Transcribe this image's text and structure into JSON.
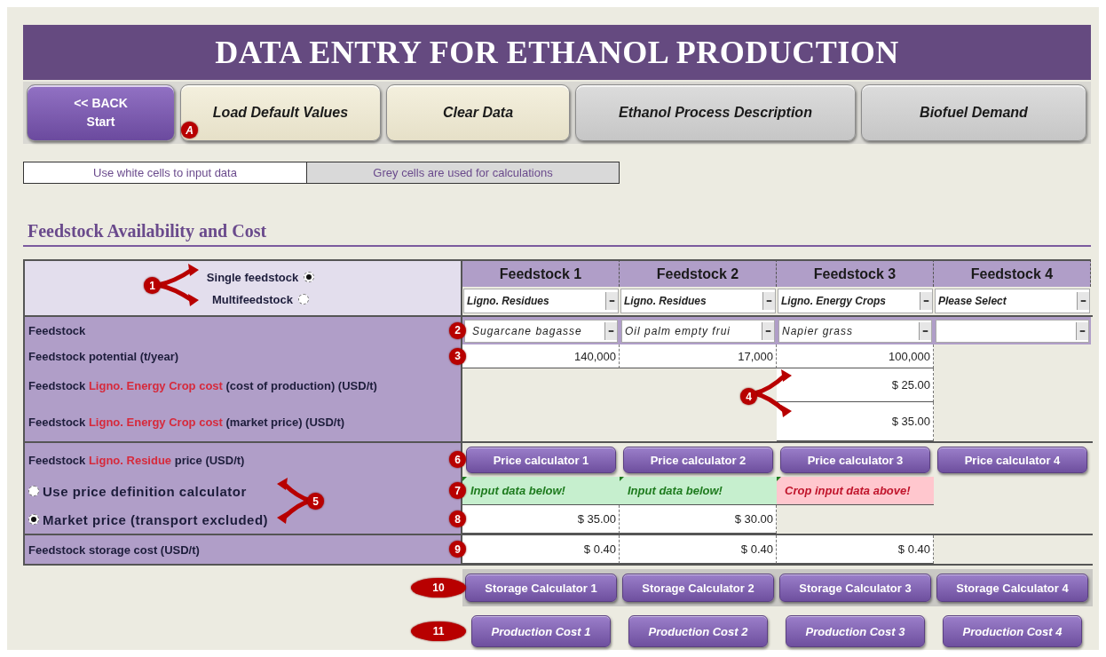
{
  "title": "DATA ENTRY FOR ETHANOL PRODUCTION",
  "nav_buttons": [
    {
      "kind": "back",
      "lines": [
        "<< BACK",
        "Start"
      ]
    },
    {
      "kind": "action",
      "lines": [
        "Load Default Values"
      ],
      "marker": "A"
    },
    {
      "kind": "action",
      "lines": [
        "Clear Data"
      ]
    },
    {
      "kind": "link",
      "lines": [
        "Ethanol Process Description"
      ]
    },
    {
      "kind": "link",
      "lines": [
        "Biofuel Demand"
      ]
    }
  ],
  "legend": [
    {
      "kind": "input",
      "text": "Use white cells to input data"
    },
    {
      "kind": "calc",
      "text": "Grey cells are used for calculations"
    }
  ],
  "section_title": "Feedstock Availability and Cost",
  "mode": {
    "marker": "1",
    "options": [
      {
        "label": "Single feedstock",
        "selected": true
      },
      {
        "label": "Multifeedstock",
        "selected": false
      }
    ]
  },
  "columns": [
    "Feedstock 1",
    "Feedstock 2",
    "Feedstock 3",
    "Feedstock 4"
  ],
  "feedstock_types": [
    "Ligno. Residues",
    "Ligno. Residues",
    "Ligno. Energy Crops",
    "Please Select"
  ],
  "row_groups": [
    [
      {
        "kind": "select",
        "marker": "2",
        "label": [
          {
            "text": "Feedstock",
            "highlight": false
          }
        ],
        "cells": [
          "Sugarcane bagasse",
          "Oil palm empty frui",
          "Napier grass",
          null
        ]
      },
      {
        "kind": "value",
        "marker": "3",
        "label": [
          {
            "text": "Feedstock potential (t/year)",
            "highlight": false
          }
        ],
        "cells": [
          "140,000",
          "17,000",
          "100,000",
          null
        ]
      },
      {
        "kind": "value",
        "callout": "4",
        "label": [
          {
            "text": "Feedstock ",
            "highlight": false
          },
          {
            "text": "Ligno. Energy Crop cost",
            "highlight": true
          },
          {
            "text": " (cost of production) (USD/t)",
            "highlight": false
          }
        ],
        "cells": [
          null,
          null,
          "$ 25.00",
          null
        ]
      },
      {
        "kind": "value",
        "label": [
          {
            "text": "Feedstock ",
            "highlight": false
          },
          {
            "text": "Ligno. Energy Crop cost",
            "highlight": true
          },
          {
            "text": " (market price) (USD/t)",
            "highlight": false
          }
        ],
        "cells": [
          null,
          null,
          "$ 35.00",
          null
        ]
      }
    ],
    [
      {
        "kind": "buttons",
        "marker": "6",
        "label": [
          {
            "text": "Feedstock ",
            "highlight": false
          },
          {
            "text": "Ligno. Residue",
            "highlight": true
          },
          {
            "text": " price (USD/t)",
            "highlight": false
          }
        ],
        "cells": [
          "Price calculator 1",
          "Price calculator 2",
          "Price calculator 3",
          "Price calculator 4"
        ]
      },
      {
        "kind": "status",
        "marker": "7",
        "callout": "5",
        "option": {
          "label": "Use price definition calculator",
          "selected": false
        },
        "cells": [
          {
            "text": "Input data below!",
            "kind": "ok"
          },
          {
            "text": "Input data below!",
            "kind": "ok"
          },
          {
            "text": "Crop input data above!",
            "kind": "warn"
          },
          null
        ]
      },
      {
        "kind": "value",
        "marker": "8",
        "option": {
          "label": "Market price (transport excluded)",
          "selected": true
        },
        "cells": [
          "$ 35.00",
          "$ 30.00",
          null,
          null
        ]
      }
    ],
    [
      {
        "kind": "value",
        "marker": "9",
        "label": [
          {
            "text": "Feedstock storage cost (USD/t)",
            "highlight": false
          }
        ],
        "cells": [
          "$ 0.40",
          "$ 0.40",
          "$ 0.40",
          null
        ]
      }
    ]
  ],
  "button_rows": [
    {
      "kind": "calculator",
      "marker": "10",
      "buttons": [
        "Storage Calculator 1",
        "Storage Calculator 2",
        "Storage Calculator 3",
        "Storage Calculator 4"
      ]
    },
    {
      "kind": "report",
      "marker": "11",
      "buttons": [
        "Production Cost 1",
        "Production Cost 2",
        "Production Cost 3",
        "Production Cost 4"
      ]
    }
  ]
}
